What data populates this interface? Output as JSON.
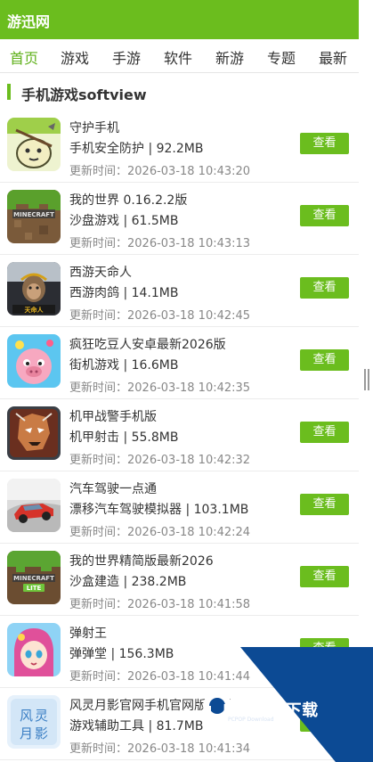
{
  "header": {
    "logo": "游迅网"
  },
  "nav": [
    {
      "label": "首页",
      "active": true
    },
    {
      "label": "游戏"
    },
    {
      "label": "手游"
    },
    {
      "label": "软件"
    },
    {
      "label": "新游"
    },
    {
      "label": "专题"
    },
    {
      "label": "最新"
    }
  ],
  "section": {
    "title": "手机游戏softview"
  },
  "apps": [
    {
      "name": "守护手机",
      "meta": "手机安全防护 | 92.2MB",
      "time": "更新时间：2026-03-18 10:43:20",
      "button": "查看",
      "icon": "guard-phone-app-icon"
    },
    {
      "name": "我的世界 0.16.2.2版",
      "meta": "沙盘游戏 | 61.5MB",
      "time": "更新时间：2026-03-18 10:43:13",
      "button": "查看",
      "icon": "minecraft-app-icon"
    },
    {
      "name": "西游天命人",
      "meta": "西游肉鸽 | 14.1MB",
      "time": "更新时间：2026-03-18 10:42:45",
      "button": "查看",
      "icon": "monkey-king-app-icon"
    },
    {
      "name": "疯狂吃豆人安卓最新2026版",
      "meta": "街机游戏 | 16.6MB",
      "time": "更新时间：2026-03-18 10:42:35",
      "button": "查看",
      "icon": "cartoon-pig-app-icon"
    },
    {
      "name": "机甲战警手机版",
      "meta": "机甲射击 | 55.8MB",
      "time": "更新时间：2026-03-18 10:42:32",
      "button": "查看",
      "icon": "mech-warrior-app-icon"
    },
    {
      "name": "汽车驾驶一点通",
      "meta": "漂移汽车驾驶模拟器 | 103.1MB",
      "time": "更新时间：2026-03-18 10:42:24",
      "button": "查看",
      "icon": "drift-car-app-icon"
    },
    {
      "name": "我的世界精简版最新2026",
      "meta": "沙盒建造 | 238.2MB",
      "time": "更新时间：2026-03-18 10:41:58",
      "button": "查看",
      "icon": "minecraft-lite-app-icon"
    },
    {
      "name": "弹射王",
      "meta": "弹弹堂 | 156.3MB",
      "time": "更新时间：2026-03-18 10:41:44",
      "button": "查看",
      "icon": "anime-girl-app-icon"
    },
    {
      "name": "风灵月影官网手机官网版本新",
      "meta": "游戏辅助工具 | 81.7MB",
      "time": "更新时间：2026-03-18 10:41:34",
      "button": "查看",
      "icon": "fengling-yueying-app-icon"
    }
  ],
  "watermark": {
    "text": "PCPOP下载",
    "sub": "PCPOP Download"
  },
  "colors": {
    "accent": "#6bbd1e",
    "watermark_blue": "#0c4a94"
  }
}
